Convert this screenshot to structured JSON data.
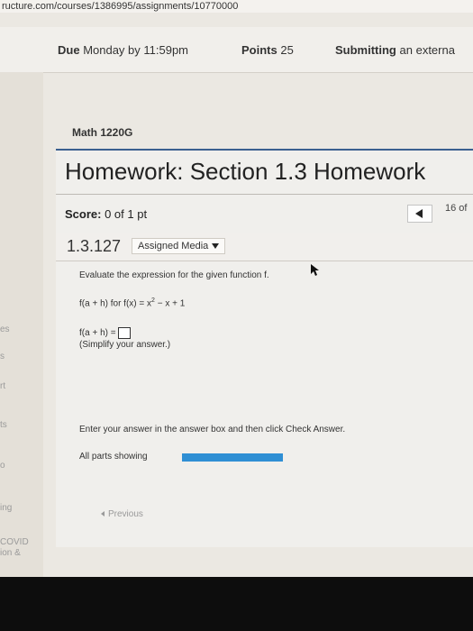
{
  "browser": {
    "url": "ructure.com/courses/1386995/assignments/10770000"
  },
  "assignment": {
    "due_label": "Due",
    "due_value": "Monday by 11:59pm",
    "points_label": "Points",
    "points_value": "25",
    "submitting_label": "Submitting",
    "submitting_value": "an externa"
  },
  "sidebar": {
    "items": [
      "es",
      "s",
      "rt",
      "ts",
      "o",
      "ing",
      "COVID",
      "ion &"
    ]
  },
  "course": {
    "name": "Math 1220G"
  },
  "homework": {
    "title": "Homework: Section 1.3 Homework",
    "score_label": "Score:",
    "score_value": "0 of 1 pt",
    "question_count": "16 of"
  },
  "question": {
    "number": "1.3.127",
    "media_label": "Assigned Media",
    "prompt": "Evaluate the expression for the given function f.",
    "expression_prefix": "f(a + h) for f(x) = x",
    "exponent": "2",
    "expression_suffix": " − x + 1",
    "answer_label": "f(a + h) =",
    "hint": "(Simplify your answer.)"
  },
  "footer": {
    "instruction": "Enter your answer in the answer box and then click Check Answer.",
    "parts_label": "All parts showing",
    "progress": 1.0,
    "previous_label": "Previous"
  },
  "colors": {
    "accent": "#3a5f8f",
    "progress": "#2f8fd4"
  },
  "icons": [
    "chevron-left-icon",
    "chevron-down-icon",
    "mouse-pointer-icon",
    "answer-input-box"
  ]
}
